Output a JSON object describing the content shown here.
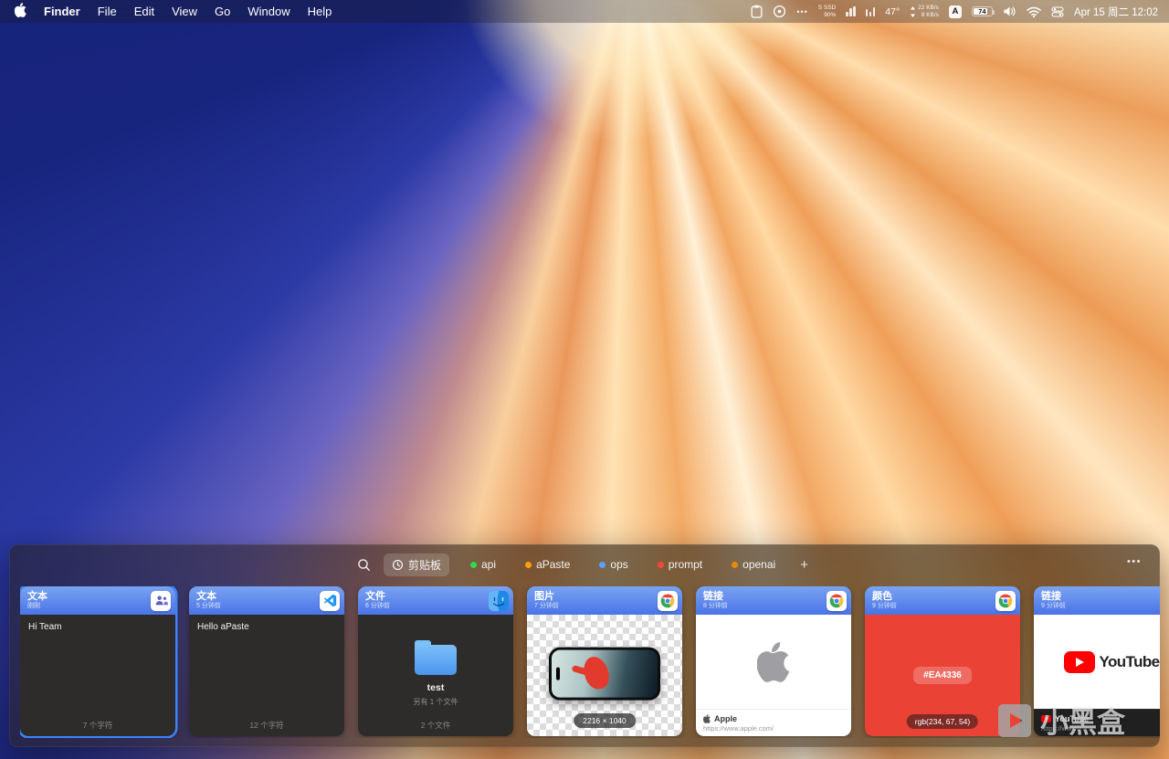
{
  "colors": {
    "accent": "#3F83F8",
    "card_header_top": "#79A3F2",
    "card_header_bottom": "#4A74E6",
    "swatch": "#EA4336",
    "dot_api": "#32D74B",
    "dot_apaste": "#FF9F0A",
    "dot_ops": "#5E9EFF",
    "dot_prompt": "#FF453A",
    "dot_openai": "#E8890C"
  },
  "menubar": {
    "app_name": "Finder",
    "menus": [
      "File",
      "Edit",
      "View",
      "Go",
      "Window",
      "Help"
    ],
    "status": {
      "more": "•••",
      "disk_line1": "S SSD",
      "disk_line2": "90%",
      "temperature": "47°",
      "net_up": "22 KB/s",
      "net_down": "8 KB/s",
      "input_source": "A",
      "battery_percent": "74",
      "clock": "Apr 15 周二 12:02"
    }
  },
  "panel": {
    "tabs": [
      {
        "label": "剪贴板",
        "selected": true
      },
      {
        "label": "api"
      },
      {
        "label": "aPaste"
      },
      {
        "label": "ops"
      },
      {
        "label": "prompt"
      },
      {
        "label": "openai"
      }
    ],
    "add_label": "+",
    "more_label": "•••"
  },
  "cards": [
    {
      "type": "文本",
      "time": "刚刚",
      "app": "teams",
      "body_text": "Hi Team",
      "footer": "7 个字符"
    },
    {
      "type": "文本",
      "time": "5 分钟前",
      "app": "vscode",
      "body_text": "Hello aPaste",
      "footer": "12 个字符"
    },
    {
      "type": "文件",
      "time": "6 分钟前",
      "app": "finder",
      "file_name": "test",
      "file_extra": "另有 1 个文件",
      "footer": "2 个文件"
    },
    {
      "type": "图片",
      "time": "7 分钟前",
      "app": "chrome",
      "badge": "2216 × 1040"
    },
    {
      "type": "链接",
      "time": "8 分钟前",
      "app": "chrome",
      "site_title": "Apple",
      "site_url": "https://www.apple.com/"
    },
    {
      "type": "颜色",
      "time": "9 分钟前",
      "app": "chrome",
      "hex": "#EA4336",
      "rgb": "rgb(234, 67, 54)"
    },
    {
      "type": "链接",
      "time": "9 分钟前",
      "app": "chrome",
      "logo_text": "YouTube",
      "site_title": "YouTube",
      "site_url": "https://www."
    }
  ],
  "watermark": {
    "text": "小黑盒"
  }
}
